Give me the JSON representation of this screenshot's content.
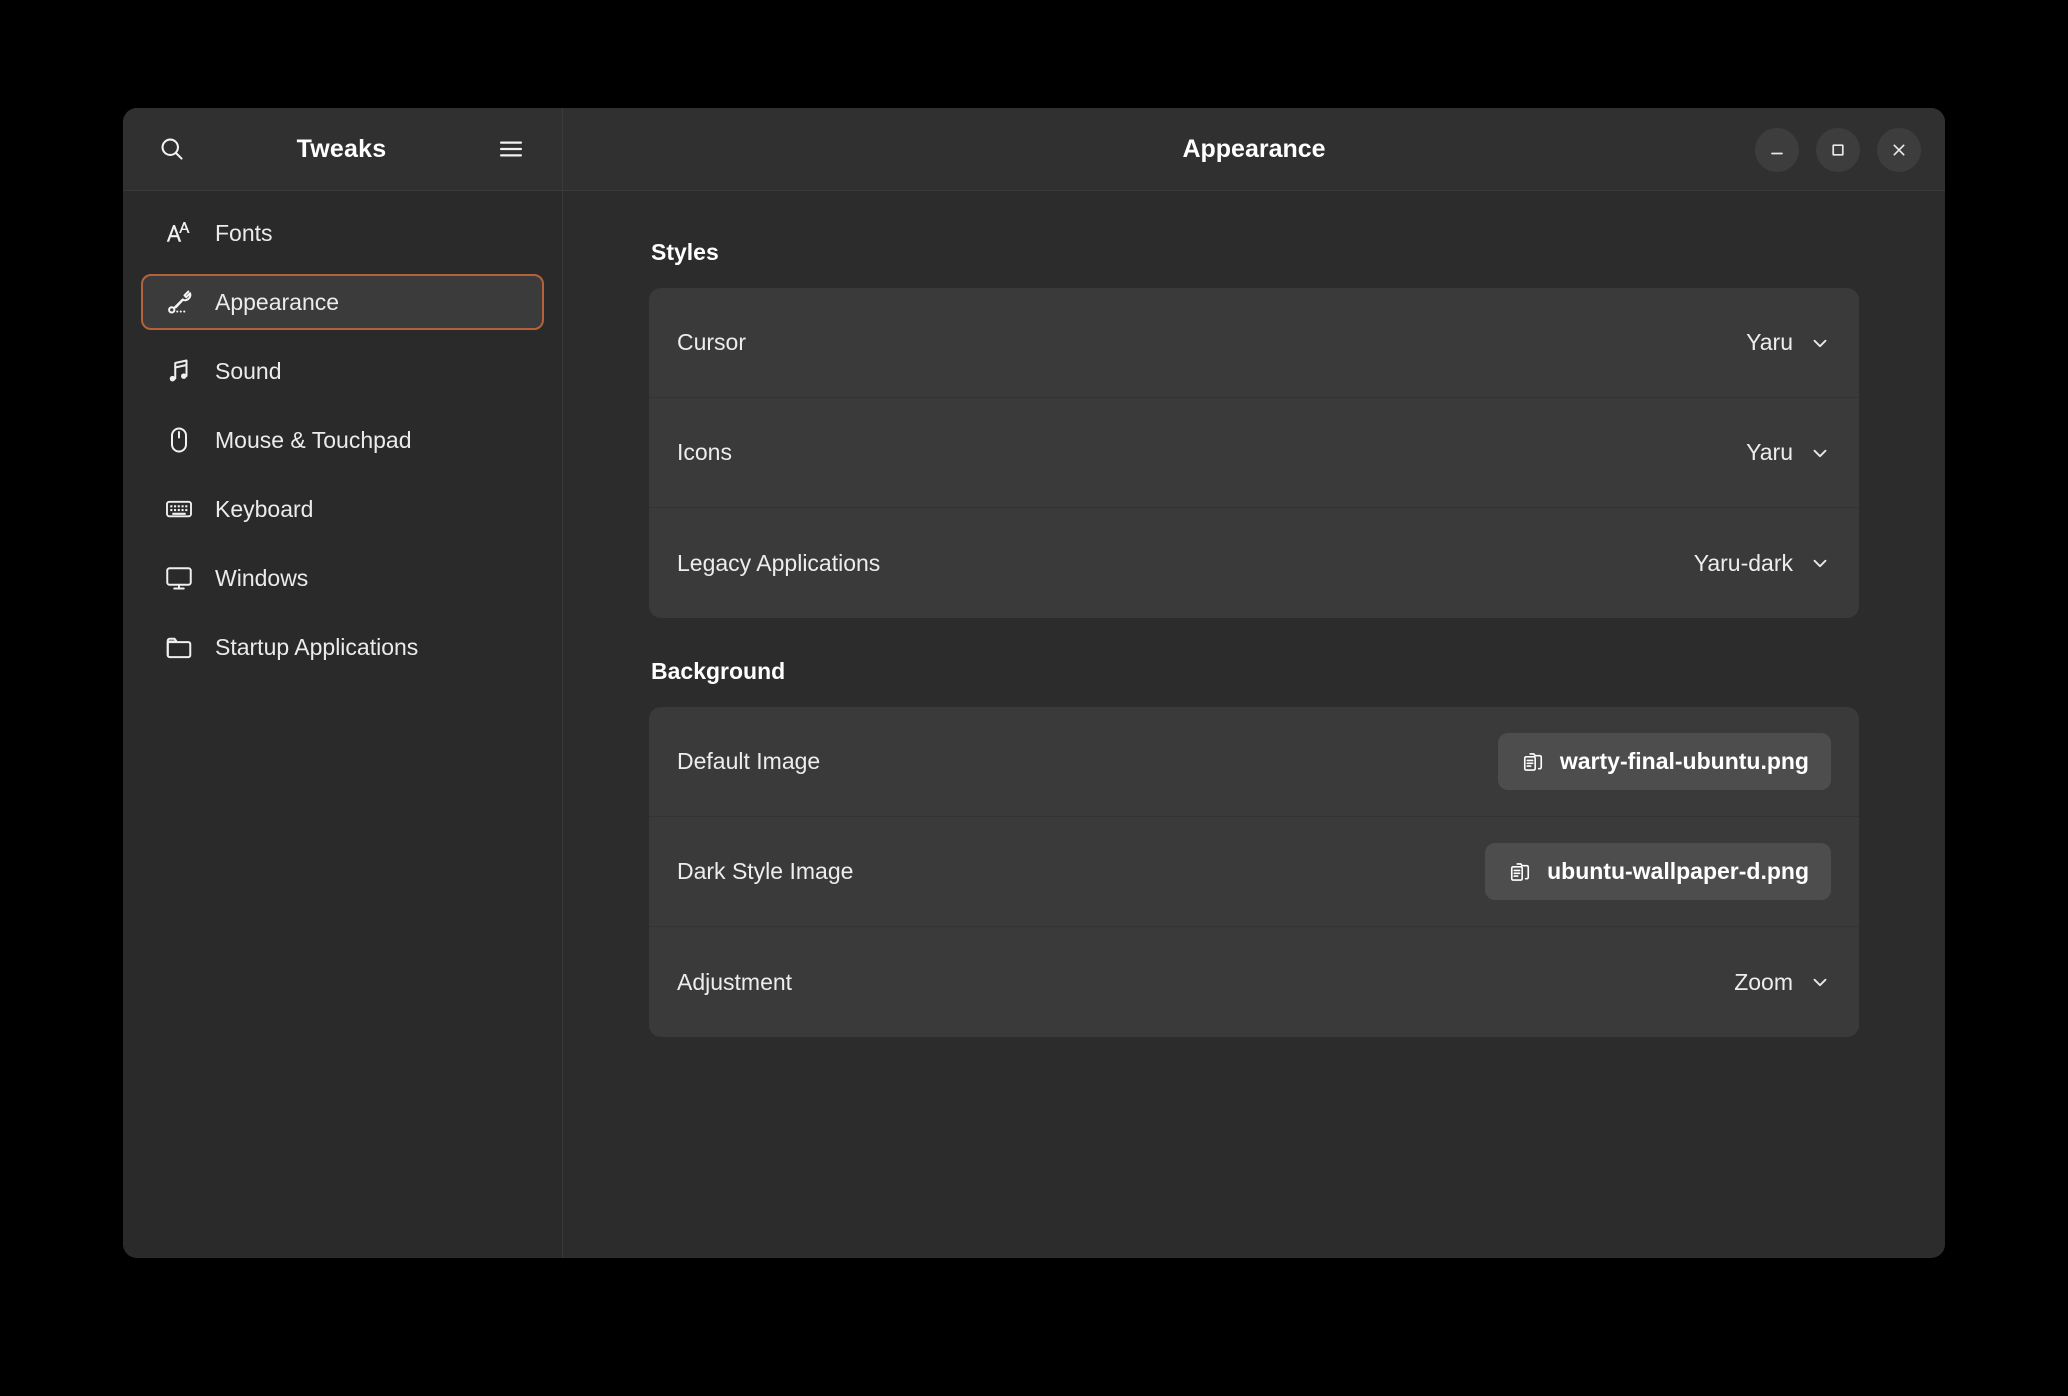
{
  "window": {
    "app_title": "Tweaks",
    "page_title": "Appearance",
    "controls": [
      {
        "name": "minimize",
        "label": "Minimize"
      },
      {
        "name": "maximize",
        "label": "Maximize"
      },
      {
        "name": "close",
        "label": "Close"
      }
    ],
    "search_icon": "search-icon",
    "menu_icon": "hamburger-menu-icon"
  },
  "sidebar": {
    "items": [
      {
        "label": "Fonts",
        "icon": "fonts-icon",
        "selected": false
      },
      {
        "label": "Appearance",
        "icon": "wrench-icon",
        "selected": true
      },
      {
        "label": "Sound",
        "icon": "music-note-icon",
        "selected": false
      },
      {
        "label": "Mouse & Touchpad",
        "icon": "mouse-icon",
        "selected": false
      },
      {
        "label": "Keyboard",
        "icon": "keyboard-icon",
        "selected": false
      },
      {
        "label": "Windows",
        "icon": "monitor-icon",
        "selected": false
      },
      {
        "label": "Startup Applications",
        "icon": "folder-icon",
        "selected": false
      }
    ]
  },
  "main": {
    "sections": [
      {
        "title": "Styles",
        "rows": [
          {
            "label": "Cursor",
            "value": "Yaru",
            "control": "dropdown"
          },
          {
            "label": "Icons",
            "value": "Yaru",
            "control": "dropdown"
          },
          {
            "label": "Legacy Applications",
            "value": "Yaru-dark",
            "control": "dropdown"
          }
        ]
      },
      {
        "title": "Background",
        "rows": [
          {
            "label": "Default Image",
            "value": "warty-final-ubuntu.png",
            "control": "file"
          },
          {
            "label": "Dark Style Image",
            "value": "ubuntu-wallpaper-d.png",
            "control": "file"
          },
          {
            "label": "Adjustment",
            "value": "Zoom",
            "control": "dropdown"
          }
        ]
      }
    ]
  },
  "colors": {
    "desktop": "#000000",
    "window_bg": "#2c2c2c",
    "headerbar": "#303030",
    "sidebar": "#2a2a2a",
    "card": "#3a3a3a",
    "accent_focus": "#b3623c",
    "file_button": "#4d4d4d",
    "text": "#ededed"
  }
}
